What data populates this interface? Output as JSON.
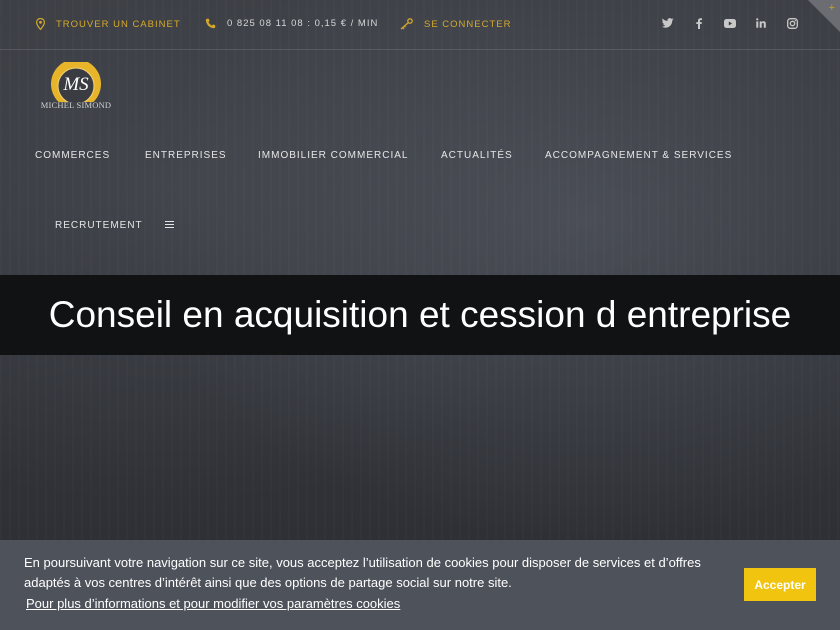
{
  "topbar": {
    "find_office": "TROUVER UN CABINET",
    "phone": "0 825 08 11 08 : 0,15 € / MIN",
    "login": "SE CONNECTER",
    "social_icons": [
      "twitter-icon",
      "facebook-icon",
      "youtube-icon",
      "linkedin-icon",
      "instagram-icon"
    ]
  },
  "logo": {
    "monogram": "MS",
    "name": "MICHEL SIMOND"
  },
  "nav": {
    "items": [
      "COMMERCES",
      "ENTREPRISES",
      "IMMOBILIER COMMERCIAL",
      "ACTUALITÉS",
      "ACCOMPAGNEMENT & SERVICES",
      "RECRUTEMENT"
    ],
    "menu_icon": "hamburger-menu-icon"
  },
  "hero": {
    "title": "Conseil en acquisition et cession d entreprise"
  },
  "cookie": {
    "message": "En poursuivant votre navigation sur ce site, vous acceptez l’utilisation de cookies pour disposer de services et d’offres adaptés à vos centres d’intérêt ainsi que des options de partage social sur notre site.",
    "link": "Pour plus d’informations et pour modifier vos paramètres cookies",
    "accept": "Accepter"
  },
  "colors": {
    "accent": "#d4a92a",
    "accept_button": "#f1c40f",
    "cookie_bar": "#4e525a",
    "title_band": "#111214"
  }
}
